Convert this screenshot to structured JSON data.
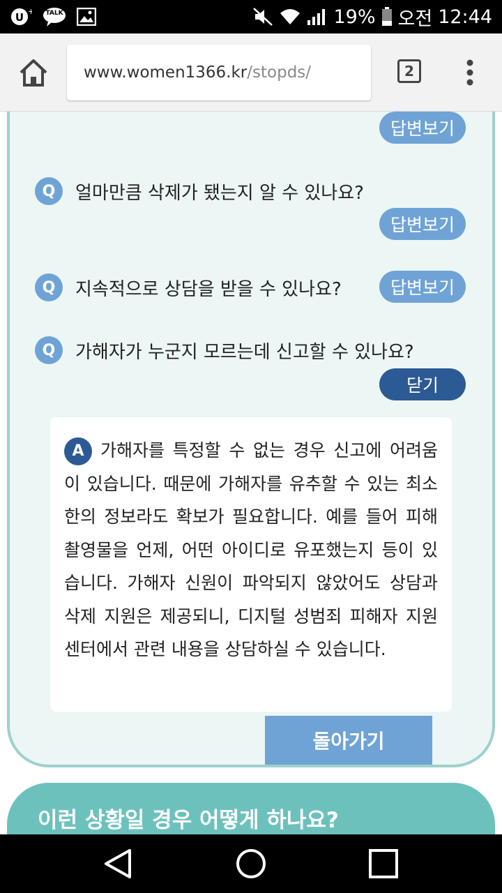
{
  "status_bar": {
    "battery": "19%",
    "ampm": "오전",
    "time": "12:44",
    "talk_label": "TALK"
  },
  "browser": {
    "url_domain": "www.women1366.kr",
    "url_path": "/stopds/",
    "tab_count": "2"
  },
  "faq": {
    "answer_view_label": "답변보기",
    "close_label": "닫기",
    "q_marker": "Q",
    "a_marker": "A",
    "questions": [
      {
        "text": "얼마만큼 삭제가 됐는지 알 수 있나요?"
      },
      {
        "text": "지속적으로 상담을 받을 수 있나요?"
      },
      {
        "text": "가해자가 누군지 모르는데 신고할 수 있나요?"
      }
    ],
    "answer": "가해자를 특정할 수 없는 경우 신고에 어려움이 있습니다. 때문에 가해자를 유추할 수 있는 최소한의 정보라도 확보가 필요합니다. 예를 들어 피해 촬영물을 언제, 어떤 아이디로 유포했는지 등이 있습니다. 가해자 신원이 파악되지 않았어도 상담과 삭제 지원은 제공되니, 디지털 성범죄 피해자 지원센터에서 관련 내용을 상담하실 수 있습니다.",
    "back_label": "돌아가기"
  },
  "situation": {
    "title": "이런 상황일 경우 어떻게 하나요?"
  },
  "colors": {
    "panel_bg": "#ecf6f4",
    "panel_border": "#9fd0cc",
    "pill_light": "#6fa3d6",
    "pill_dark": "#2c5a94",
    "teal_header": "#6dc1bd"
  }
}
